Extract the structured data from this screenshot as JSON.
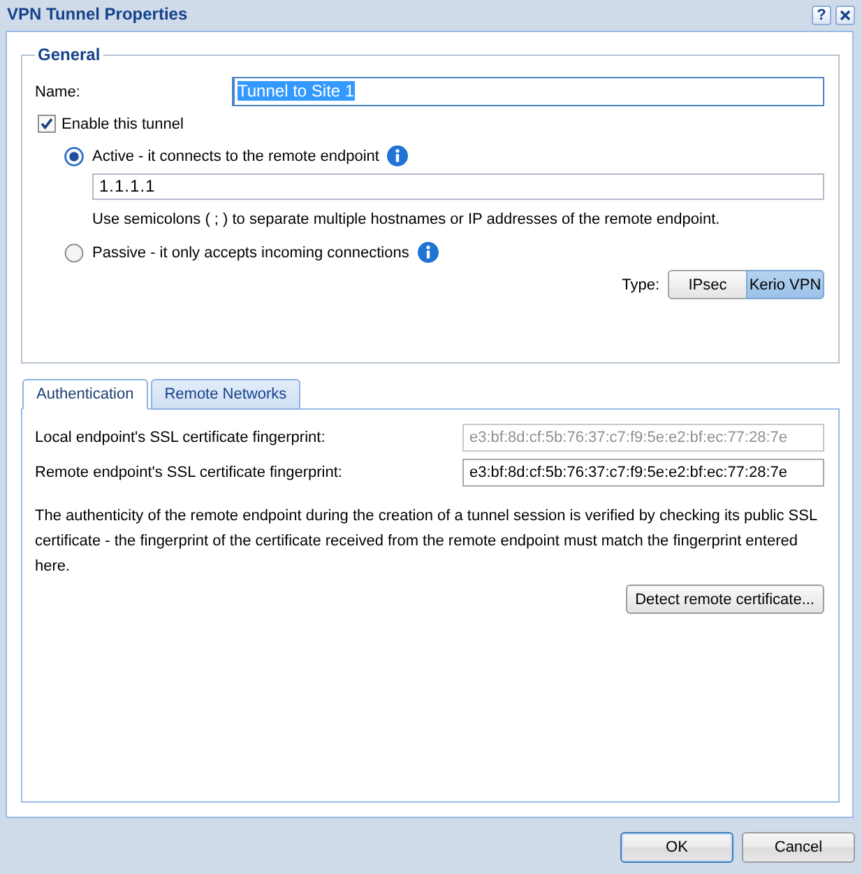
{
  "window": {
    "title": "VPN Tunnel Properties",
    "help_button": "?"
  },
  "general": {
    "legend": "General",
    "name": {
      "label": "Name:",
      "value": "Tunnel to Site 1",
      "focused": true,
      "text_selected": true
    },
    "enable": {
      "label": "Enable this tunnel",
      "checked": true
    },
    "modes": [
      {
        "label": "Active - it connects to the remote endpoint",
        "selected": true,
        "address": "1.1.1.1",
        "hint": "Use semicolons ( ; ) to separate multiple hostnames or IP addresses of the remote endpoint."
      },
      {
        "label": "Passive - it only accepts incoming connections",
        "selected": false
      }
    ],
    "type": {
      "label": "Type:",
      "options": [
        {
          "label": "IPsec",
          "selected": false
        },
        {
          "label": "Kerio VPN",
          "selected": true
        }
      ]
    }
  },
  "tabs": [
    {
      "label": "Authentication",
      "selected": true
    },
    {
      "label": "Remote Networks",
      "selected": false
    }
  ],
  "authentication": {
    "fields": [
      {
        "label": "Local endpoint's SSL certificate fingerprint:",
        "value": "e3:bf:8d:cf:5b:76:37:c7:f9:5e:e2:bf:ec:77:28:7e",
        "disabled": true
      },
      {
        "label": "Remote endpoint's SSL certificate fingerprint:",
        "value": "e3:bf:8d:cf:5b:76:37:c7:f9:5e:e2:bf:ec:77:28:7e",
        "disabled": false
      }
    ],
    "description": "The authenticity of the remote endpoint during the creation of a tunnel session is verified by checking its public SSL certificate - the fingerprint of the certificate received from the remote endpoint must match the fingerprint entered here.",
    "detect_button": "Detect remote certificate..."
  },
  "buttons": [
    {
      "label": "OK",
      "focused": true
    },
    {
      "label": "Cancel",
      "focused": false
    }
  ]
}
